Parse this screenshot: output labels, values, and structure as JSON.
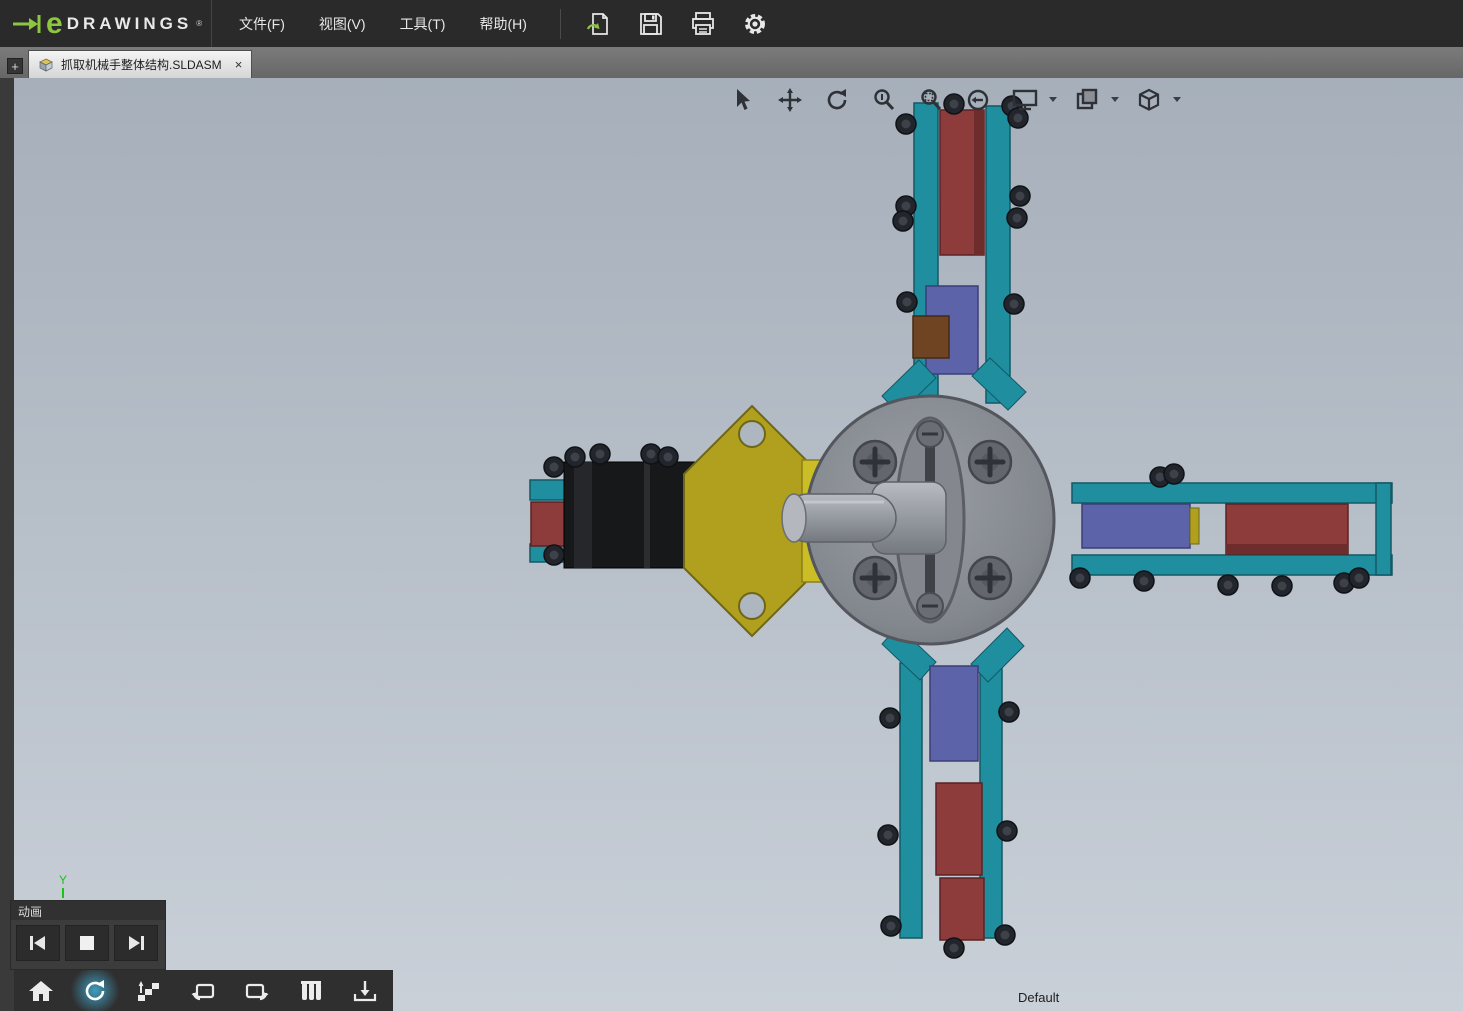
{
  "app": {
    "logo_e": "e",
    "logo_text": "DRAWINGS",
    "logo_reg": "®"
  },
  "menu": {
    "items": [
      {
        "label": "文件(F)"
      },
      {
        "label": "视图(V)"
      },
      {
        "label": "工具(T)"
      },
      {
        "label": "帮助(H)"
      }
    ]
  },
  "main_toolbar": {
    "buttons": [
      {
        "name": "open"
      },
      {
        "name": "save"
      },
      {
        "name": "print"
      },
      {
        "name": "options"
      }
    ]
  },
  "tab_bar": {
    "new_tab_label": "+",
    "tabs": [
      {
        "title": "抓取机械手整体结构.SLDASM",
        "close_label": "×",
        "active": true
      }
    ]
  },
  "viewport": {
    "axis_label": "Y",
    "config_label": "Default",
    "view_toolbar": {
      "buttons": [
        {
          "name": "select"
        },
        {
          "name": "pan"
        },
        {
          "name": "rotate"
        },
        {
          "name": "zoom"
        },
        {
          "name": "zoom-area"
        },
        {
          "name": "previous-view"
        },
        {
          "name": "fullscreen",
          "has_dropdown": true
        },
        {
          "name": "markup",
          "has_dropdown": true
        },
        {
          "name": "view-orientation",
          "has_dropdown": true
        }
      ]
    }
  },
  "animation_panel": {
    "title": "动画",
    "buttons": [
      {
        "name": "first-frame"
      },
      {
        "name": "stop"
      },
      {
        "name": "last-frame"
      }
    ]
  },
  "bottom_toolbar": {
    "buttons": [
      {
        "name": "home"
      },
      {
        "name": "animation",
        "active": true
      },
      {
        "name": "exploded-view"
      },
      {
        "name": "view-back"
      },
      {
        "name": "view-forward"
      },
      {
        "name": "display-style"
      },
      {
        "name": "save-view"
      }
    ]
  },
  "colors": {
    "accent_green": "#8dc63f",
    "teal": "#1f8fa0",
    "dark_red": "#8e3b3c",
    "purple": "#5c63a8",
    "hub_gray": "#8a8e94",
    "yellow": "#b0a01d",
    "yellow_light": "#cabd25",
    "motor_black": "#17181a",
    "bolt_dark": "#22262c",
    "viewport_top": "#a6afba",
    "viewport_bottom": "#c9d0d8"
  }
}
